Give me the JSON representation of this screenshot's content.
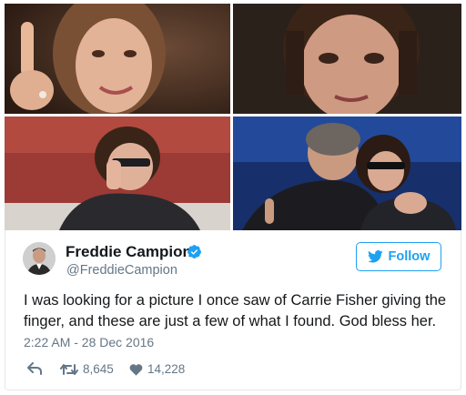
{
  "images": [
    {
      "alt": "photo-top-left"
    },
    {
      "alt": "photo-top-right"
    },
    {
      "alt": "photo-bottom-left"
    },
    {
      "alt": "photo-bottom-right"
    }
  ],
  "tweet": {
    "display_name": "Freddie Campion",
    "handle": "@FreddieCampion",
    "follow_label": "Follow",
    "text": "I was looking for a picture I once saw of Carrie Fisher giving the finger, and these are just a few of what I found. God bless her.",
    "timestamp": "2:22 AM - 28 Dec 2016",
    "retweets": "8,645",
    "likes": "14,228"
  },
  "colors": {
    "accent": "#1da1f2",
    "muted": "#657786",
    "text": "#14171a"
  },
  "icons": {
    "verified": "verified-badge-icon",
    "follow": "twitter-bird-icon",
    "reply": "reply-arrow-icon",
    "retweet": "retweet-icon",
    "like": "heart-icon"
  }
}
